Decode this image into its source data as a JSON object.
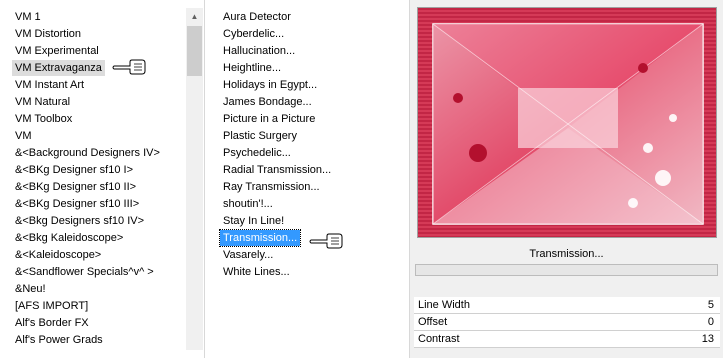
{
  "left_list": {
    "items": [
      "VM 1",
      "VM Distortion",
      "VM Experimental",
      "VM Extravaganza",
      "VM Instant Art",
      "VM Natural",
      "VM Toolbox",
      "VM",
      "&<Background Designers IV>",
      "&<BKg Designer sf10 I>",
      "&<BKg Designer sf10 II>",
      "&<BKg Designer sf10 III>",
      "&<Bkg Designers sf10 IV>",
      "&<Bkg Kaleidoscope>",
      "&<Kaleidoscope>",
      "&<Sandflower Specials^v^ >",
      "&Neu!",
      "[AFS IMPORT]",
      "Alf's Border FX",
      "Alf's Power Grads"
    ],
    "selected_index": 3
  },
  "middle_list": {
    "items": [
      "Aura Detector",
      "Cyberdelic...",
      "Hallucination...",
      "Heightline...",
      "Holidays in Egypt...",
      "James Bondage...",
      "Picture in a Picture",
      "Plastic Surgery",
      "Psychedelic...",
      "Radial Transmission...",
      "Ray Transmission...",
      "shoutin'!...",
      "Stay In Line!",
      "Transmission...",
      "Vasarely...",
      "White Lines..."
    ],
    "selected_index": 13
  },
  "preview": {
    "effect_name": "Transmission...",
    "progress": 0
  },
  "params": [
    {
      "label": "Line Width",
      "value": "5"
    },
    {
      "label": "Offset",
      "value": "0"
    },
    {
      "label": "Contrast",
      "value": "13"
    }
  ],
  "icons": {
    "pointer": "pointing-hand-icon"
  },
  "colors": {
    "selection": "#3399ff",
    "preview_red": "#c8284a"
  }
}
